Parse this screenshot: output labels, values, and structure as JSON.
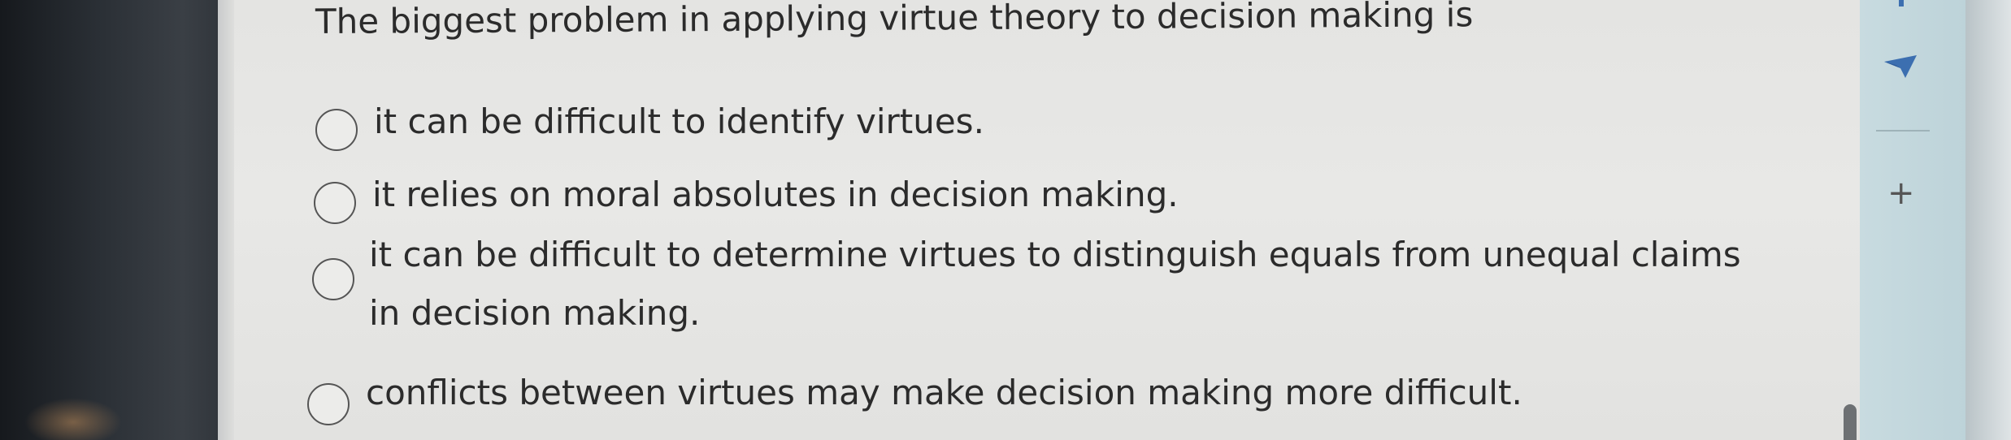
{
  "question": {
    "text": "The biggest problem in applying virtue theory to decision making is"
  },
  "options": [
    {
      "line1": "it can be difficult to identify virtues.",
      "line2": ""
    },
    {
      "line1": "it relies on moral absolutes in decision making.",
      "line2": ""
    },
    {
      "line1": "it can be difficult to determine virtues to distinguish equals from unequal claims",
      "line2": "in decision making."
    },
    {
      "line1": "conflicts between virtues may make decision making more difficult.",
      "line2": ""
    }
  ],
  "sidebar": {
    "plus_label": "+",
    "icons": [
      "send-icon",
      "plus-icon"
    ]
  },
  "colors": {
    "screen": "#e6e6e4",
    "text": "#2b2b2b",
    "sidebar": "#c4d8dd",
    "bezel": "#2a2f35",
    "send_icon": "#3c6fb0"
  }
}
